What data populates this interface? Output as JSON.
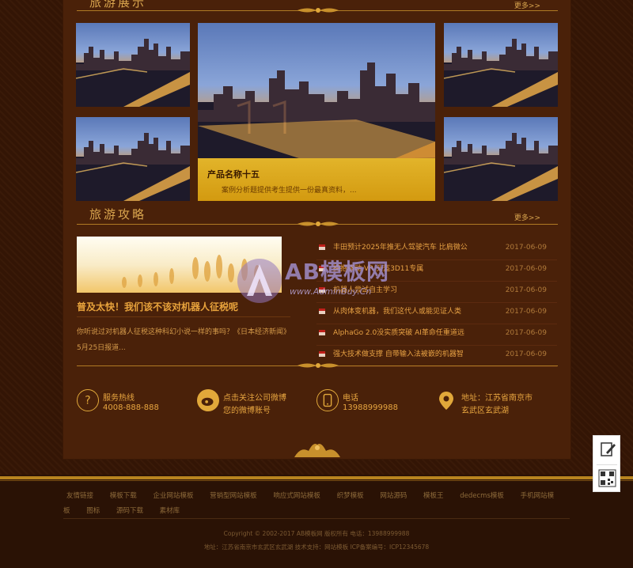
{
  "sections": {
    "top": {
      "title": "旅游展示",
      "more": "更多>>"
    },
    "guide": {
      "title": "旅游攻略",
      "more": "更多>>"
    }
  },
  "featured": {
    "caption_title": "产品名称十五",
    "caption_desc": "案例分析题提供考生提供一份最真资料，..."
  },
  "news_main": {
    "headline": "普及太快！我们该不该对机器人征税呢",
    "desc": "你听说过对机器人征税这种科幻小说一样的事吗？《日本经济新闻》5月25日报道..."
  },
  "news_list": [
    {
      "title": "丰田预计2025年推无人驾驶汽车 比肩微公",
      "date": "2017-06-09"
    },
    {
      "title": "拥抱移动 VR 头盔3D11专属",
      "date": "2017-06-09"
    },
    {
      "title": "机器人尝试自主学习",
      "date": "2017-06-09"
    },
    {
      "title": "从肉体变机器，我们这代人或能见证人类",
      "date": "2017-06-09"
    },
    {
      "title": "AlphaGo 2.0没实质突破 AI革命任重道远",
      "date": "2017-06-09"
    },
    {
      "title": "强大技术做支撑 自带输入法被嵌的机器智",
      "date": "2017-06-09"
    }
  ],
  "contact": [
    {
      "icon": "question-icon",
      "line1": "服务热线",
      "line2": "4008-888-888"
    },
    {
      "icon": "weibo-icon",
      "line1": "点击关注公司微博",
      "line2": "您的微博账号"
    },
    {
      "icon": "phone-icon",
      "line1": "电话",
      "line2": "13988999988"
    },
    {
      "icon": "location-icon",
      "line1": "地址：江苏省南京市",
      "line2": "玄武区玄武湖"
    }
  ],
  "watermark": {
    "logo": "AB模板网",
    "url": "www.AdminBuy.Cn"
  },
  "footer": {
    "links": [
      "友情链接",
      "模板下载",
      "企业网站模板",
      "营销型网站模板",
      "响应式网站模板",
      "织梦模板",
      "网站源码",
      "模板王",
      "dedecms模板",
      "手机网站模板",
      "图标",
      "源码下载",
      "素材库"
    ],
    "copyright": "Copyright © 2002-2017 AB模板网 版权所有     电话：13988999988",
    "address": "地址：江苏省南京市玄武区玄武湖     技术支持：网站模板     ICP备案编号：ICP12345678"
  },
  "colors": {
    "panel": "#4a2109",
    "accent": "#e1a83a",
    "caption": "#e2b42a"
  }
}
